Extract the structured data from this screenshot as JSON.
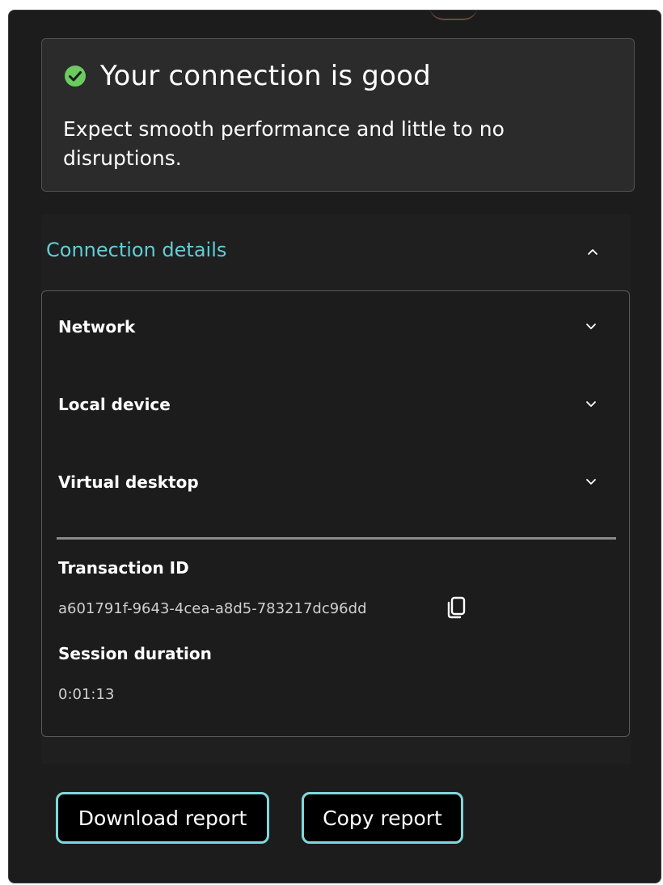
{
  "status": {
    "title": "Your connection is good",
    "description": "Expect smooth performance and little to no disruptions.",
    "icon": "check-circle-icon",
    "icon_color": "#6ccb5f"
  },
  "details": {
    "title": "Connection details",
    "expanded": true,
    "accent_color": "#60cdd6",
    "rows": [
      {
        "label": "Network",
        "expanded": false
      },
      {
        "label": "Local device",
        "expanded": false
      },
      {
        "label": "Virtual desktop",
        "expanded": false
      }
    ],
    "transaction": {
      "label": "Transaction ID",
      "value": "a601791f-9643-4cea-a8d5-783217dc96dd"
    },
    "session": {
      "label": "Session duration",
      "value": "0:01:13"
    }
  },
  "actions": {
    "download_label": "Download report",
    "copy_label": "Copy report",
    "button_border_color": "#7fd8dc"
  }
}
